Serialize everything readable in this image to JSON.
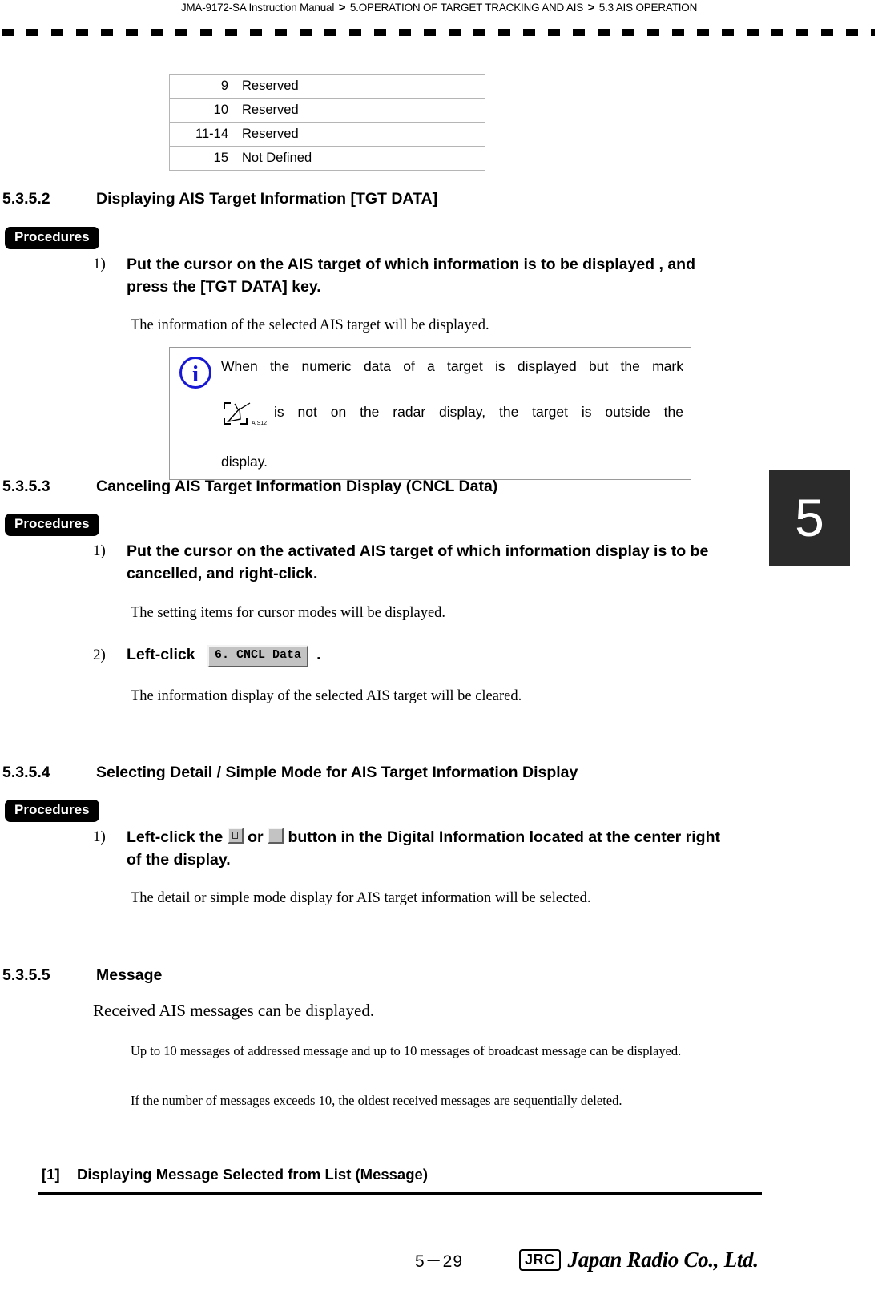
{
  "header": {
    "manual": "JMA-9172-SA Instruction Manual",
    "separator": ">",
    "chapter": "5.OPERATION OF TARGET TRACKING AND AIS",
    "section": "5.3  AIS OPERATION"
  },
  "table": {
    "rows": [
      {
        "num": "9",
        "desc": "Reserved"
      },
      {
        "num": "10",
        "desc": "Reserved"
      },
      {
        "num": "11-14",
        "desc": "Reserved"
      },
      {
        "num": "15",
        "desc": "Not Defined"
      }
    ]
  },
  "sections": {
    "s2": {
      "number": "5.3.5.2",
      "title": "Displaying AIS Target Information [TGT DATA]",
      "procedures_label": "Procedures",
      "step1_num": "1)",
      "step1_text": "Put the cursor on the AIS target of which information is to be displayed , and press the [TGT DATA] key.",
      "result_text": "The information of the selected AIS target will be displayed.",
      "note": {
        "icon": "info-icon",
        "line1": "When the numeric data of a target is displayed but the mark",
        "symbol_label": "AIS12",
        "line2": "is not on the radar display, the target is outside the",
        "line3": "display."
      }
    },
    "s3": {
      "number": "5.3.5.3",
      "title": "Canceling AIS Target Information Display (CNCL Data)",
      "procedures_label": "Procedures",
      "step1_num": "1)",
      "step1_text": "Put the cursor on the activated AIS target of which information display is to be cancelled, and right-click.",
      "result1_text": "The setting items for cursor modes will be displayed.",
      "step2_num": "2)",
      "step2_prefix": "Left-click",
      "step2_button": "6. CNCL Data",
      "step2_suffix": ".",
      "result2_text": "The information display of the selected AIS target will be cleared."
    },
    "s4": {
      "number": "5.3.5.4",
      "title": "Selecting Detail / Simple Mode for AIS Target Information Display",
      "procedures_label": "Procedures",
      "step1_num": "1)",
      "step1_part1": "Left-click the",
      "step1_or": "or",
      "step1_part2": "button in the Digital Information located at the center right of the display.",
      "result_text": "The detail or simple mode display for AIS target information will be selected."
    },
    "s5": {
      "number": "5.3.5.5",
      "title": "Message",
      "para1": "Received AIS messages can be displayed.",
      "para2": "Up to 10 messages of addressed message and up to 10 messages of broadcast message can be displayed.",
      "para3": "If the number of messages exceeds 10, the oldest received messages are sequentially deleted."
    }
  },
  "subsection": {
    "number": "[1]",
    "title": "Displaying Message Selected from List (Message)"
  },
  "chapter_tab": "5",
  "footer": {
    "page": "5－29",
    "logo_mark": "JRC",
    "logo_name": "Japan Radio Co., Ltd."
  },
  "colors": {
    "info_blue": "#1717d6",
    "tag_black": "#000000",
    "chip_gray": "#c3c3c3",
    "chapter_tab": "#2b2b2b"
  }
}
